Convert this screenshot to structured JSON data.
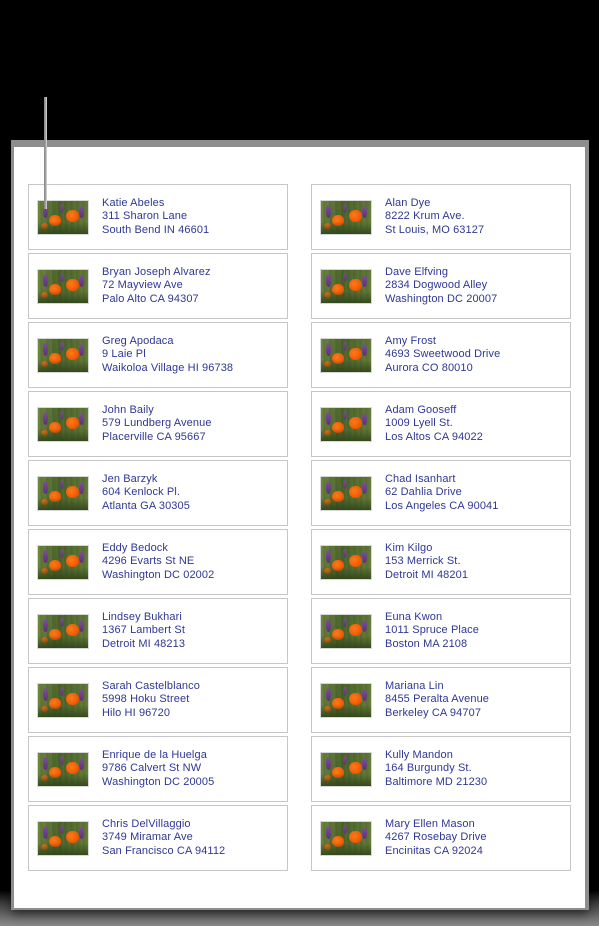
{
  "view": {
    "background_color": "#000000",
    "page_color": "#ffffff",
    "page_border_color": "#8e8e8e",
    "text_color": "#2f3794",
    "card_border_color": "#c6c6c6",
    "callout_line_color": "#a0a0a0"
  },
  "callout": {
    "name": "leader-line"
  },
  "document": {
    "thumbnail_icon": "wildflower-photo-icon",
    "columns": [
      {
        "cards": [
          {
            "name": "Katie Abeles",
            "street": "311 Sharon Lane",
            "citystate": "South Bend IN 46601"
          },
          {
            "name": "Bryan Joseph Alvarez",
            "street": "72 Mayview Ave",
            "citystate": "Palo Alto CA 94307"
          },
          {
            "name": "Greg Apodaca",
            "street": "9 Laie Pl",
            "citystate": "Waikoloa Village HI 96738"
          },
          {
            "name": "John Baily",
            "street": "579 Lundberg Avenue",
            "citystate": "Placerville CA 95667"
          },
          {
            "name": "Jen Barzyk",
            "street": "604 Kenlock Pl.",
            "citystate": "Atlanta GA 30305"
          },
          {
            "name": "Eddy Bedock",
            "street": "4296 Evarts St NE",
            "citystate": "Washington DC 02002"
          },
          {
            "name": "Lindsey Bukhari",
            "street": "1367 Lambert St",
            "citystate": "Detroit MI 48213"
          },
          {
            "name": "Sarah Castelblanco",
            "street": "5998 Hoku Street",
            "citystate": "Hilo HI 96720"
          },
          {
            "name": "Enrique de la Huelga",
            "street": "9786 Calvert St NW",
            "citystate": "Washington DC 20005"
          },
          {
            "name": "Chris DelVillaggio",
            "street": "3749 Miramar Ave",
            "citystate": "San Francisco CA 94112"
          }
        ]
      },
      {
        "cards": [
          {
            "name": "Alan Dye",
            "street": "8222 Krum Ave.",
            "citystate": "St Louis, MO 63127"
          },
          {
            "name": "Dave Elfving",
            "street": "2834 Dogwood Alley",
            "citystate": "Washington DC 20007"
          },
          {
            "name": "Amy Frost",
            "street": "4693 Sweetwood Drive",
            "citystate": "Aurora CO 80010"
          },
          {
            "name": "Adam Gooseff",
            "street": "1009 Lyell St.",
            "citystate": "Los Altos CA 94022"
          },
          {
            "name": "Chad Isanhart",
            "street": "62 Dahlia Drive",
            "citystate": "Los Angeles CA 90041"
          },
          {
            "name": "Kim Kilgo",
            "street": "153 Merrick St.",
            "citystate": "Detroit MI 48201"
          },
          {
            "name": "Euna Kwon",
            "street": "1011 Spruce Place",
            "citystate": "Boston MA 2108"
          },
          {
            "name": "Mariana Lin",
            "street": "8455 Peralta Avenue",
            "citystate": "Berkeley CA 94707"
          },
          {
            "name": "Kully Mandon",
            "street": "164 Burgundy St.",
            "citystate": "Baltimore MD 21230"
          },
          {
            "name": "Mary Ellen Mason",
            "street": "4267 Rosebay Drive",
            "citystate": "Encinitas CA 92024"
          }
        ]
      }
    ]
  }
}
